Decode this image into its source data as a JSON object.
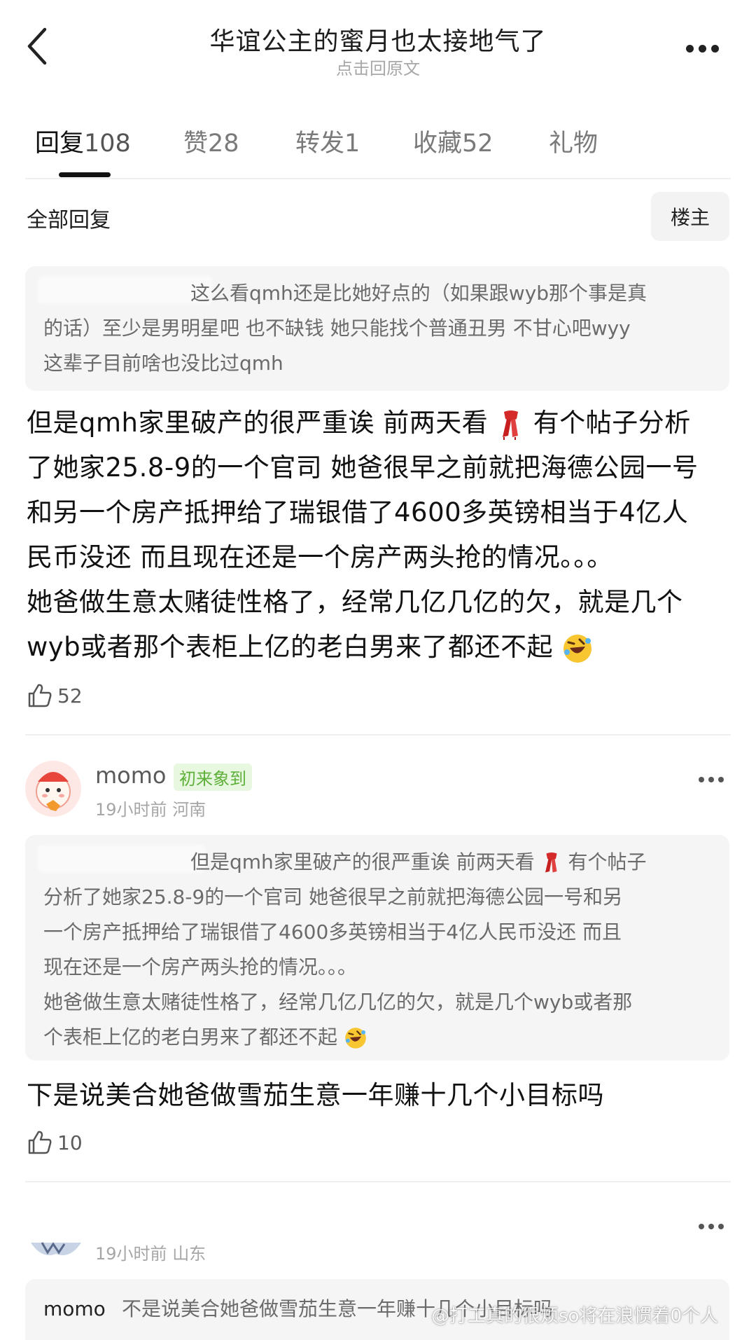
{
  "header": {
    "title": "华谊公主的蜜月也太接地气了",
    "subtitle": "点击回原文"
  },
  "tabs": [
    {
      "label": "回复",
      "count": "108",
      "active": true
    },
    {
      "label": "赞",
      "count": "28"
    },
    {
      "label": "转发",
      "count": "1"
    },
    {
      "label": "收藏",
      "count": "52"
    },
    {
      "label": "礼物",
      "count": ""
    }
  ],
  "section": {
    "all_replies_label": "全部回复",
    "owner_button_label": "楼主"
  },
  "comments": [
    {
      "quote_lines": [
        "这么看qmh还是比她好点的（如果跟wyb那个事是真",
        "的话）至少是男明星吧 也不缺钱 她只能找个普通丑男 不甘心吧wyy",
        "这辈子目前啥也没比过qmh"
      ],
      "body_lines": [
        "但是qmh家里破产的很严重诶 前两天看",
        "有个帖子分析",
        "了她家25.8-9的一个官司 她爸很早之前就把海德公园一号",
        "和另一个房产抵押给了瑞银借了4600多英镑相当于4亿人",
        "民币没还 而且现在还是一个房产两头抢的情况。。。",
        "她爸做生意太赌徒性格了，经常几亿几亿的欠，就是几个",
        "wyb或者那个表柜上亿的老白男来了都还不起"
      ],
      "likes": "52"
    },
    {
      "username": "momo",
      "badge": "初来象到",
      "time": "19小时前",
      "location": "河南",
      "quote_lines": [
        "但是qmh家里破产的很严重诶 前两天看",
        "有个帖子",
        "分析了她家25.8-9的一个官司 她爸很早之前就把海德公园一号和另",
        "一个房产抵押给了瑞银借了4600多英镑相当于4亿人民币没还 而且",
        "现在还是一个房产两头抢的情况。。。",
        "她爸做生意太赌徒性格了，经常几亿几亿的欠，就是几个wyb或者那",
        "个表柜上亿的老白男来了都还不起"
      ],
      "body": "下是说美合她爸做雪茄生意一年赚十几个小目标吗",
      "likes": "10"
    },
    {
      "time": "19小时前",
      "location": "山东",
      "quote_user": "momo",
      "quote_text": "不是说美合她爸做雪茄生意一年赚十几个小目标吗"
    }
  ],
  "watermark": "@打工真的很烦so将在浪惯着0个人",
  "icons": [
    "back-arrow-icon",
    "more-dots-icon",
    "like-thumb-icon",
    "scarf-emoji-icon",
    "rofl-emoji-icon",
    "avatar-icon"
  ]
}
